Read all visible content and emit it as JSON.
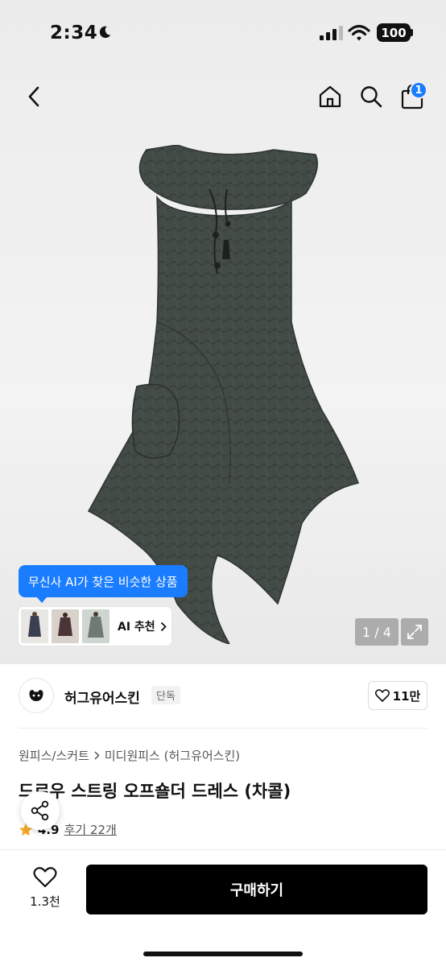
{
  "status_bar": {
    "time": "2:34",
    "battery": "100"
  },
  "nav": {
    "cart_count": "1"
  },
  "gallery": {
    "ai_tooltip": "무신사 AI가 찾은 비슷한 상품",
    "ai_recommend_label": "AI 추천",
    "pager": "1 / 4"
  },
  "brand": {
    "name": "허그유어스킨",
    "tag": "단독",
    "like_count": "11만"
  },
  "breadcrumb": [
    "원피스/스커트",
    "미디원피스 (허그유어스킨)"
  ],
  "product": {
    "title": "드로우 스트링 오프숄더 드레스 (차콜)",
    "rating": "4.9",
    "reviews": "후기 22개"
  },
  "bottom": {
    "wish_count": "1.3천",
    "buy_label": "구매하기"
  },
  "colors": {
    "accent_blue": "#1a7cff",
    "dress": "#3f4742",
    "buy_button": "#000000",
    "star": "#f5a623"
  }
}
